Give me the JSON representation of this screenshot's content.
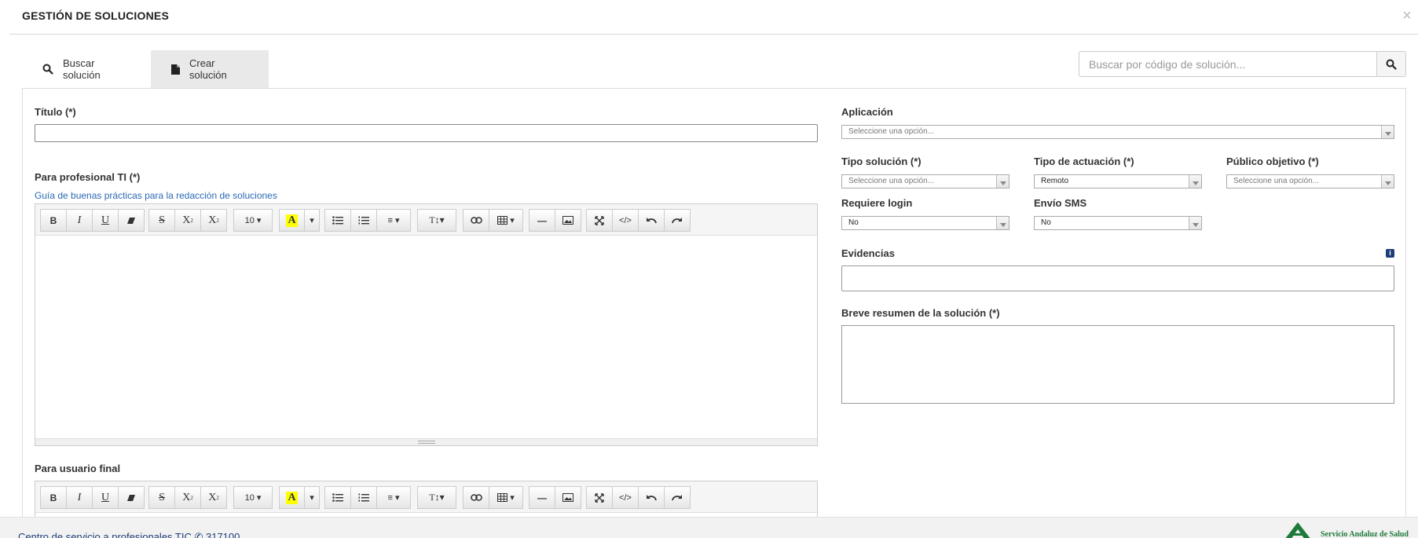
{
  "modal": {
    "title": "GESTIÓN DE SOLUCIONES",
    "close_icon": "×"
  },
  "tabs": {
    "search_label": "Buscar solución",
    "create_label": "Crear solución"
  },
  "search": {
    "placeholder": "Buscar por código de solución..."
  },
  "form": {
    "title_label": "Título (*)",
    "pro_label": "Para profesional TI (*)",
    "guide_link": "Guía de buenas prácticas para la redacción de soluciones",
    "final_label": "Para usuario final",
    "app_label": "Aplicación",
    "app_placeholder": "Seleccione una opción...",
    "tipo_solucion_label": "Tipo solución (*)",
    "tipo_solucion_placeholder": "Seleccione una opción...",
    "tipo_actuacion_label": "Tipo de actuación (*)",
    "tipo_actuacion_value": "Remoto",
    "publico_label": "Público objetivo (*)",
    "publico_placeholder": "Seleccione una opción...",
    "login_label": "Requiere login",
    "login_value": "No",
    "sms_label": "Envío SMS",
    "sms_value": "No",
    "evidencias_label": "Evidencias",
    "evidencias_info_icon": "i",
    "resumen_label": "Breve resumen de la solución (*)"
  },
  "toolbar": {
    "bold": "B",
    "italic": "I",
    "underline": "U",
    "strike": "S",
    "superscript": "X",
    "subscript": "X",
    "font_size": "10 ▾",
    "highlight": "A",
    "dropdown": "▾",
    "align": "≡ ▾",
    "text_style": "T↕▾",
    "table": "▾",
    "hr": "—",
    "code": "</>"
  },
  "footer": {
    "left_text": "Centro de servicio a profesionales TIC ✆ 317100",
    "right_text": "Servicio Andaluz de Salud"
  },
  "colors": {
    "accent_link": "#2a6ab5",
    "brand_green": "#1e7a39",
    "footer_blue": "#1f3f7a",
    "highlight_yellow": "#ffff00"
  }
}
